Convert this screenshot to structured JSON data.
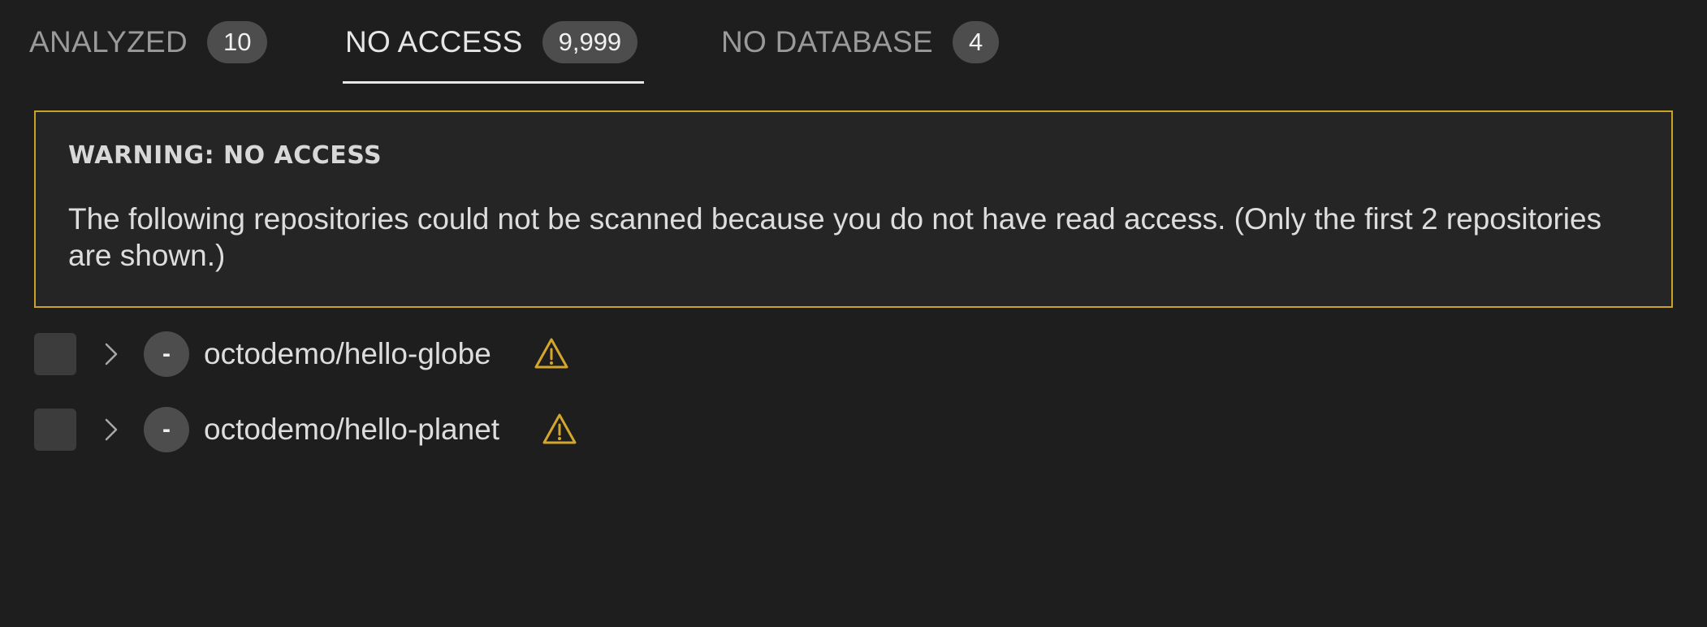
{
  "tabs": [
    {
      "label": "ANALYZED",
      "count": "10",
      "active": false
    },
    {
      "label": "NO ACCESS",
      "count": "9,999",
      "active": true
    },
    {
      "label": "NO DATABASE",
      "count": "4",
      "active": false
    }
  ],
  "warning": {
    "title": "WARNING: NO ACCESS",
    "message": "The following repositories could not be scanned because you do not have read access. (Only the first 2 repositories are shown.)"
  },
  "repos": [
    {
      "status": "-",
      "name": "octodemo/hello-globe",
      "icon": "warning-icon"
    },
    {
      "status": "-",
      "name": "octodemo/hello-planet",
      "icon": "warning-icon"
    }
  ],
  "colors": {
    "background": "#1e1e1e",
    "warning_border": "#c9a227",
    "badge": "#4d4d4d",
    "active_underline": "#e6e6e6"
  }
}
